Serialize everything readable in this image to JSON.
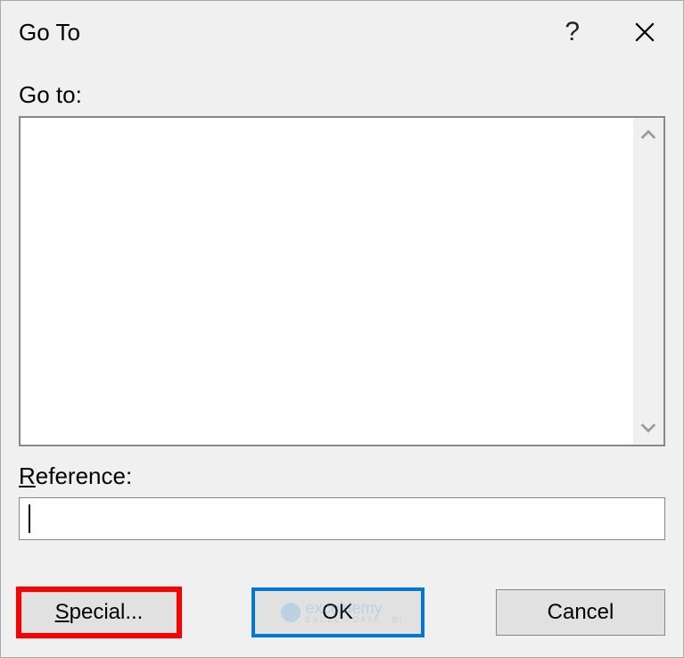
{
  "dialog": {
    "title": "Go To",
    "help_symbol": "?",
    "goto_label": "Go to:",
    "reference_label_prefix": "R",
    "reference_label_rest": "eference:",
    "reference_value": ""
  },
  "buttons": {
    "special_prefix": "S",
    "special_rest": "pecial...",
    "ok": "OK",
    "cancel": "Cancel"
  },
  "watermark": {
    "brand": "exceldemy",
    "tagline": "EXCEL · DATA · BI"
  }
}
